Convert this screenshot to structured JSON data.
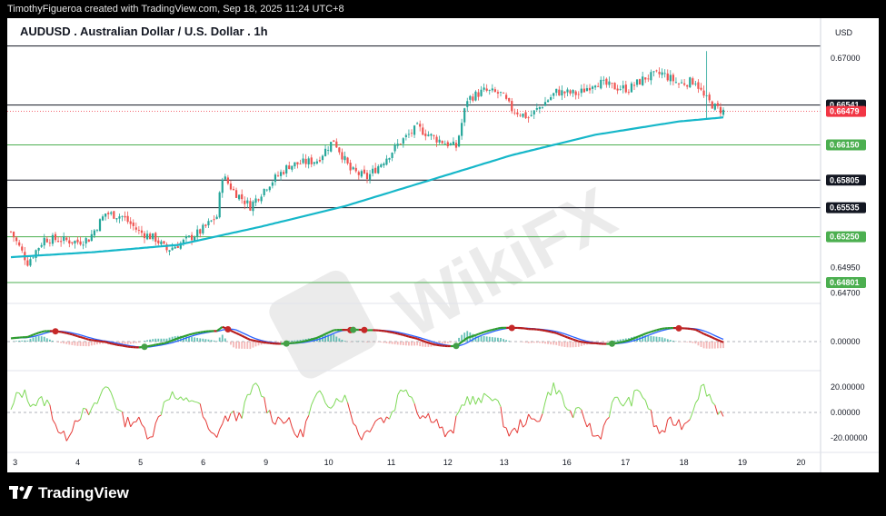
{
  "caption": "TimothyFigueroa created with TradingView.com, Sep 18, 2025 11:24 UTC+8",
  "brand": "TradingView",
  "watermark": "WikiFX",
  "colors": {
    "bull": "#26a69a",
    "bear": "#ef5350",
    "ema": "#16b7c9",
    "level_green": "#4caf50",
    "level_black": "#131722",
    "last_price": "#f23645",
    "osc_green": "#2e9d2e",
    "osc_blue": "#2962ff",
    "osc_red": "#b71c1c",
    "rsi_green": "#7ed957",
    "rsi_red": "#e53935"
  },
  "chart_data": {
    "type": "candlestick",
    "title": "AUDUSD . Australian Dollar / U.S. Dollar . 1h",
    "currency": "USD",
    "ylim": [
      0.6465,
      0.6717
    ],
    "x_ticks": [
      "3",
      "4",
      "5",
      "6",
      "9",
      "10",
      "11",
      "12",
      "13",
      "16",
      "17",
      "18",
      "19",
      "20"
    ],
    "y_ticks": [
      "0.67000",
      "0.64950",
      "0.64700"
    ],
    "levels": [
      {
        "label": "0.66541",
        "value": 0.66541,
        "style": "black"
      },
      {
        "label": "0.66150",
        "value": 0.6615,
        "style": "green"
      },
      {
        "label": "0.65805",
        "value": 0.65805,
        "style": "black"
      },
      {
        "label": "0.65535",
        "value": 0.65535,
        "style": "black"
      },
      {
        "label": "0.65250",
        "value": 0.6525,
        "style": "green"
      },
      {
        "label": "0.64801",
        "value": 0.64801,
        "style": "green"
      }
    ],
    "top_line": 0.6712,
    "last_price": {
      "label": "0.66479",
      "value": 0.66479
    },
    "close_path": [
      [
        0,
        0.653
      ],
      [
        6,
        0.65
      ],
      [
        12,
        0.6523
      ],
      [
        18,
        0.6522
      ],
      [
        24,
        0.652
      ],
      [
        28,
        0.6523
      ],
      [
        34,
        0.6548
      ],
      [
        40,
        0.6545
      ],
      [
        46,
        0.653
      ],
      [
        52,
        0.6523
      ],
      [
        56,
        0.6512
      ],
      [
        62,
        0.652
      ],
      [
        68,
        0.653
      ],
      [
        74,
        0.6545
      ],
      [
        76,
        0.6585
      ],
      [
        80,
        0.657
      ],
      [
        86,
        0.6555
      ],
      [
        92,
        0.6575
      ],
      [
        100,
        0.6595
      ],
      [
        110,
        0.66
      ],
      [
        116,
        0.662
      ],
      [
        122,
        0.659
      ],
      [
        128,
        0.6583
      ],
      [
        134,
        0.66
      ],
      [
        140,
        0.6618
      ],
      [
        146,
        0.6632
      ],
      [
        152,
        0.6622
      ],
      [
        158,
        0.6615
      ],
      [
        160,
        0.6613
      ],
      [
        164,
        0.666
      ],
      [
        170,
        0.6668
      ],
      [
        176,
        0.6665
      ],
      [
        180,
        0.665
      ],
      [
        186,
        0.6642
      ],
      [
        190,
        0.6652
      ],
      [
        196,
        0.6667
      ],
      [
        204,
        0.6665
      ],
      [
        210,
        0.6677
      ],
      [
        216,
        0.6672
      ],
      [
        222,
        0.667
      ],
      [
        228,
        0.6681
      ],
      [
        234,
        0.6685
      ],
      [
        240,
        0.6675
      ],
      [
        246,
        0.6678
      ],
      [
        249,
        0.6662
      ],
      [
        253,
        0.6652
      ],
      [
        256,
        0.6648
      ]
    ],
    "special_wick": {
      "index": 250,
      "high": 0.6707,
      "low": 0.664
    },
    "ema_path": [
      [
        0,
        0.6505
      ],
      [
        30,
        0.651
      ],
      [
        60,
        0.6517
      ],
      [
        90,
        0.6535
      ],
      [
        120,
        0.6555
      ],
      [
        150,
        0.658
      ],
      [
        180,
        0.6605
      ],
      [
        210,
        0.6625
      ],
      [
        240,
        0.6638
      ],
      [
        256,
        0.6642
      ]
    ],
    "osc_zero_label": "0.00000",
    "osc_ticks": [
      "20.00000",
      "0.00000",
      "-20.00000"
    ]
  }
}
